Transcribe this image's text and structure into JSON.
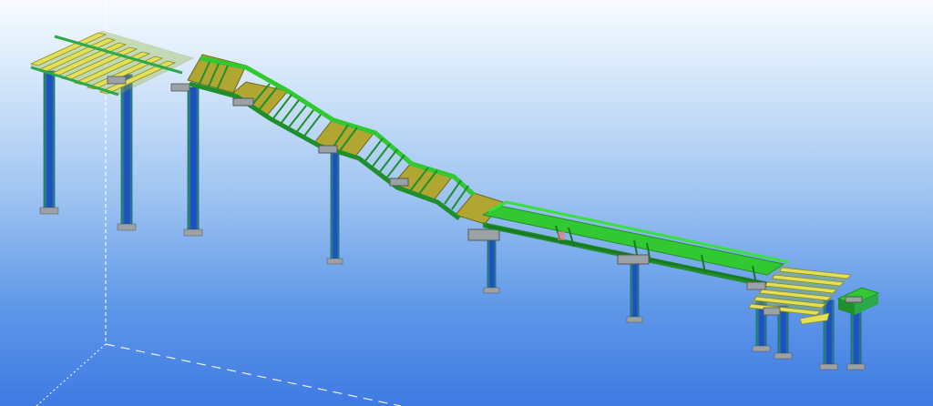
{
  "viewport": {
    "background_top": "#f7fbff",
    "background_bottom": "#3f7ae3",
    "colors": {
      "steel_green": "#32c832",
      "steel_green_dark": "#1f8f2a",
      "column_blue": "#1f4fc4",
      "deck_olive": "#b0a631",
      "plate_yellow": "#e2df58",
      "plate_yellow_dark": "#a9a428",
      "base_grey": "#9aa2a8",
      "grid_line": "#ffffff"
    },
    "icons": [
      "dashed-grid-axis",
      "3d-steel-model"
    ]
  }
}
